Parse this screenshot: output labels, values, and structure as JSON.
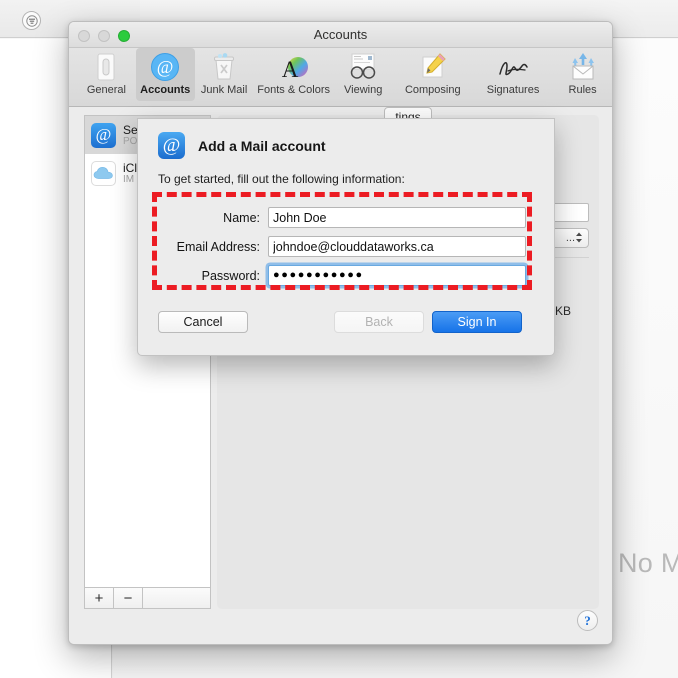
{
  "background_app": {
    "name": "Mail",
    "filter_icon": "filter-sort-icon",
    "empty_state_text": "No M"
  },
  "prefs_window": {
    "title": "Accounts",
    "traffic_lights": {
      "close": "close-button",
      "minimize": "minimize-button",
      "zoom": "zoom-button",
      "close_color": "#d8d8d8",
      "minimize_color": "#d8d8d8",
      "zoom_color": "#2bcc3e"
    },
    "toolbar": {
      "items": [
        {
          "label": "General",
          "icon": "general-icon",
          "selected": false
        },
        {
          "label": "Accounts",
          "icon": "accounts-at-icon",
          "selected": true
        },
        {
          "label": "Junk Mail",
          "icon": "junk-mail-trash-icon",
          "selected": false
        },
        {
          "label": "Fonts & Colors",
          "icon": "fonts-colors-icon",
          "selected": false
        },
        {
          "label": "Viewing",
          "icon": "viewing-glasses-icon",
          "selected": false
        },
        {
          "label": "Composing",
          "icon": "composing-pencil-icon",
          "selected": false
        },
        {
          "label": "Signatures",
          "icon": "signatures-icon",
          "selected": false
        },
        {
          "label": "Rules",
          "icon": "rules-envelope-icon",
          "selected": false
        }
      ]
    },
    "account_list": {
      "accounts": [
        {
          "name": "Se",
          "type": "PO",
          "icon": "at-account-icon",
          "selected": true
        },
        {
          "name": "iCl",
          "type": "IM",
          "icon": "icloud-cloud-icon",
          "selected": false
        }
      ],
      "add_label": "+",
      "remove_label": "−"
    },
    "detail": {
      "tab_label": "tings",
      "size_unit": "KB",
      "popup_value": "...",
      "help_label": "?"
    }
  },
  "sheet": {
    "icon": "mail-account-at-icon",
    "title": "Add a Mail account",
    "subtitle": "To get started, fill out the following information:",
    "fields": [
      {
        "label": "Name:",
        "value": "John Doe",
        "name": "name-field",
        "focused": false,
        "type": "text"
      },
      {
        "label": "Email Address:",
        "value": "johndoe@clouddataworks.ca",
        "name": "email-field",
        "focused": false,
        "type": "text"
      },
      {
        "label": "Password:",
        "value": "●●●●●●●●●●●",
        "name": "password-field",
        "focused": true,
        "type": "password"
      }
    ],
    "buttons": {
      "cancel": "Cancel",
      "back": "Back",
      "back_disabled": true,
      "signin": "Sign In",
      "signin_color": "#1673e8"
    }
  },
  "annotation": {
    "shape": "dashed-rectangle",
    "color": "#ec1c23",
    "target": "credential-fields-group"
  }
}
